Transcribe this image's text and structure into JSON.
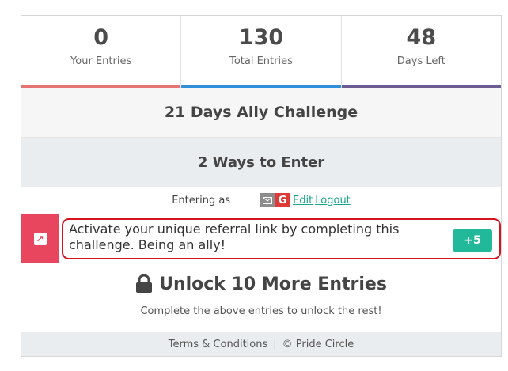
{
  "stats": [
    {
      "value": "0",
      "label": "Your Entries",
      "color": "#e57373"
    },
    {
      "value": "130",
      "label": "Total Entries",
      "color": "#2f8fd8"
    },
    {
      "value": "48",
      "label": "Days Left",
      "color": "#6b5c93"
    }
  ],
  "title": "21 Days Ally Challenge",
  "ways": "2 Ways to Enter",
  "entering": {
    "as_label": "Entering as",
    "mail_icon": "mail-icon",
    "google_icon": "google-icon",
    "edit_label": "Edit",
    "logout_label": "Logout"
  },
  "entry": {
    "icon": "external-link-icon",
    "text": "Activate your unique referral link by completing this challenge. Being an ally!",
    "points": "+5"
  },
  "unlock": {
    "icon": "lock-icon",
    "title": "Unlock 10 More Entries",
    "subtitle": "Complete the above entries to unlock the rest!"
  },
  "footer": {
    "terms": "Terms & Conditions",
    "separator": "|",
    "copyright": "© Pride Circle"
  },
  "colors": {
    "entry_accent": "#e8455f",
    "points_badge": "#21b99a",
    "highlight_outline": "#d4131f",
    "link": "#17a589"
  }
}
